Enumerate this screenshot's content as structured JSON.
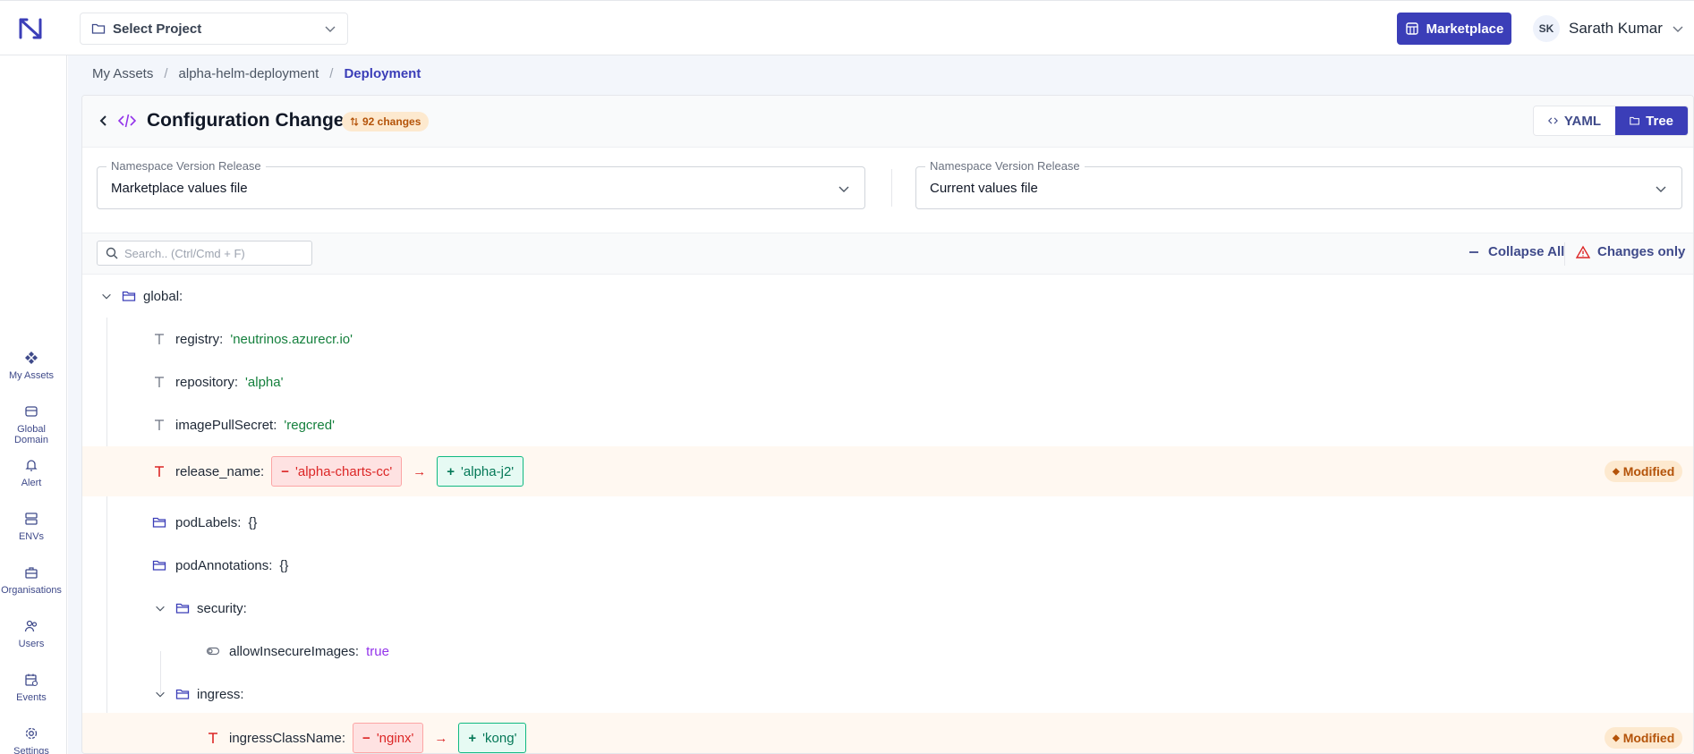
{
  "topbar": {
    "project_select": "Select Project",
    "marketplace": "Marketplace",
    "user_initials": "SK",
    "user_name": "Sarath Kumar"
  },
  "sidebar": {
    "items": [
      {
        "label": "My Assets",
        "icon": "assets-icon"
      },
      {
        "label": "Global Domain",
        "icon": "store-icon"
      },
      {
        "label": "Alert",
        "icon": "bell-icon"
      },
      {
        "label": "ENVs",
        "icon": "server-icon"
      },
      {
        "label": "Organisations",
        "icon": "briefcase-icon"
      },
      {
        "label": "Users",
        "icon": "users-icon"
      },
      {
        "label": "Events",
        "icon": "calendar-icon"
      },
      {
        "label": "Settings",
        "icon": "gear-icon"
      }
    ]
  },
  "breadcrumb": {
    "items": [
      "My Assets",
      "alpha-helm-deployment"
    ],
    "current": "Deployment",
    "separator": "/"
  },
  "header": {
    "title": "Configuration Changes",
    "changes_badge": "92 changes",
    "yaml_label": "YAML",
    "tree_label": "Tree"
  },
  "selectors": {
    "left": {
      "legend": "Namespace Version Release",
      "value": "Marketplace values file"
    },
    "right": {
      "legend": "Namespace Version Release",
      "value": "Current values file"
    }
  },
  "toolbar": {
    "search_placeholder": "Search.. (Ctrl/Cmd + F)",
    "collapse_all": "Collapse All",
    "changes_only": "Changes only"
  },
  "tree": {
    "global_key": "global:",
    "registry": {
      "key": "registry:",
      "value": "'neutrinos.azurecr.io'"
    },
    "repository": {
      "key": "repository:",
      "value": "'alpha'"
    },
    "image_pull_secret": {
      "key": "imagePullSecret:",
      "value": "'regcred'"
    },
    "release_name": {
      "key": "release_name:",
      "old": "'alpha-charts-cc'",
      "new": "'alpha-j2'",
      "status": "Modified"
    },
    "pod_labels": {
      "key": "podLabels:",
      "value": "{}"
    },
    "pod_annotations": {
      "key": "podAnnotations:",
      "value": "{}"
    },
    "security_key": "security:",
    "allow_insecure": {
      "key": "allowInsecureImages:",
      "value": "true"
    },
    "ingress_key": "ingress:",
    "ingress_class": {
      "key": "ingressClassName:",
      "old": "'nginx'",
      "new": "'kong'",
      "status": "Modified"
    },
    "minus_sign": "−",
    "plus_sign": "+",
    "arrow": "→",
    "modified_dot": "◆"
  },
  "colors": {
    "accent": "#3b3eb8",
    "removed": "#dc2626",
    "added": "#047857",
    "modified": "#b45309"
  }
}
